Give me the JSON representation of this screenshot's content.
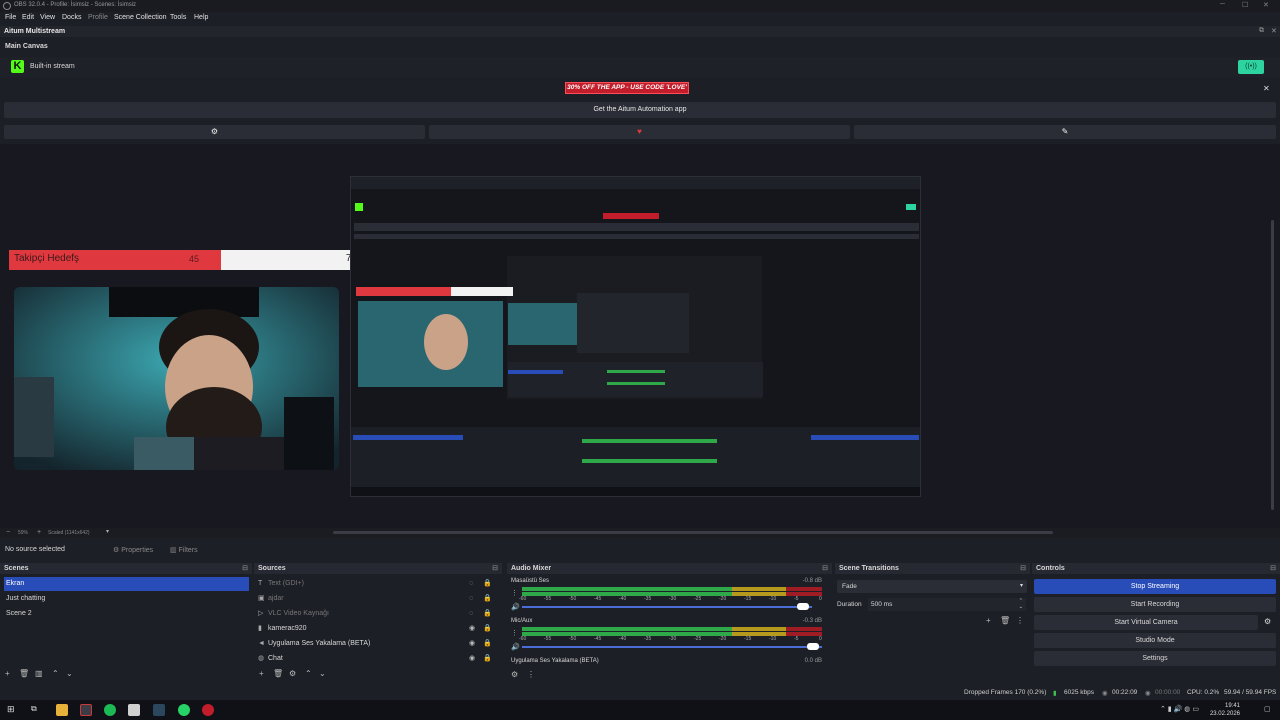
{
  "window": {
    "title": "OBS 32.0.4 - Profile: İsimsiz - Scenes: İsimsiz"
  },
  "menu": {
    "items": [
      "File",
      "Edit",
      "View",
      "Docks",
      "Profile",
      "Scene Collection",
      "Tools",
      "Help"
    ]
  },
  "aitum": {
    "dock_title": "Aitum Multistream",
    "canvas_label": "Main Canvas",
    "stream_label": "Built-in stream",
    "promo": "30% OFF THE APP - USE CODE 'LOVE'",
    "get_app": "Get the Aitum Automation app"
  },
  "overlay": {
    "goal_label": "Takipçi Hedefş",
    "goal_current": "45",
    "goal_total": "75",
    "goal_progress": 0.6
  },
  "preview": {
    "zoom": "59%",
    "scaled": "Scaled (1141x642)"
  },
  "source_toolbar": {
    "no_selection": "No source selected",
    "properties": "Properties",
    "filters": "Filters"
  },
  "scenes": {
    "title": "Scenes",
    "items": [
      "Ekran",
      "Just chatting",
      "Scene 2"
    ]
  },
  "sources": {
    "title": "Sources",
    "items": [
      "Text (GDI+)",
      "ajdar",
      "VLC Video Kaynağı",
      "kamerac920",
      "Uygulama Ses Yakalama (BETA)",
      "Chat"
    ]
  },
  "mixer": {
    "title": "Audio Mixer",
    "ch1": {
      "name": "Masaüstü Ses",
      "db": "-0.8 dB"
    },
    "ch2": {
      "name": "Mic/Aux",
      "db": "-0.3 dB"
    },
    "ch3": {
      "name": "Uygulama Ses Yakalama (BETA)",
      "db": "0.0 dB"
    },
    "ticks": [
      "-60",
      "-55",
      "-50",
      "-45",
      "-40",
      "-35",
      "-30",
      "-25",
      "-20",
      "-15",
      "-10",
      "-5",
      "0"
    ]
  },
  "transitions": {
    "title": "Scene Transitions",
    "type": "Fade",
    "duration_label": "Duration",
    "duration": "500 ms"
  },
  "controls": {
    "title": "Controls",
    "stop_streaming": "Stop Streaming",
    "start_recording": "Start Recording",
    "start_virtual_camera": "Start Virtual Camera",
    "studio_mode": "Studio Mode",
    "settings": "Settings"
  },
  "status": {
    "dropped": "Dropped Frames 170 (0.2%)",
    "bitrate": "6025 kbps",
    "stream_time": "00:22:09",
    "rec_time": "00:00:00",
    "cpu": "CPU: 0.2%",
    "fps": "59.94 / 59.94 FPS"
  },
  "taskbar": {
    "time": "19:41",
    "date": "23.02.2026"
  }
}
